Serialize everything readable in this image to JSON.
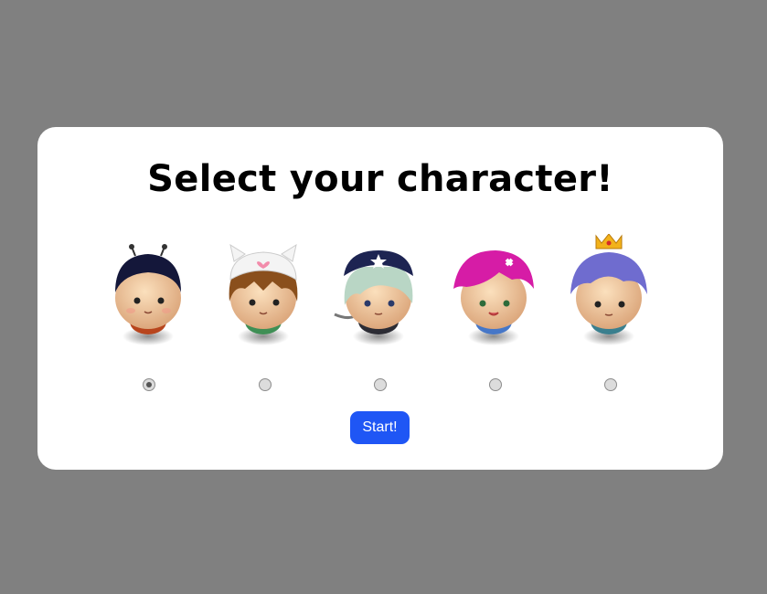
{
  "dialog": {
    "title": "Select your character!",
    "start_label": "Start!"
  },
  "characters": [
    {
      "icon": "antenna-boy-icon",
      "hair": "#14173a",
      "shirt": "#b8451d",
      "selected": true
    },
    {
      "icon": "cat-hat-girl-icon",
      "hair": "#8a4f1c",
      "shirt": "#3f8f55",
      "selected": false
    },
    {
      "icon": "pirate-icon",
      "hair": "#b9d6c5",
      "shirt": "#2c2c34",
      "selected": false
    },
    {
      "icon": "pink-hair-girl-icon",
      "hair": "#d61ca6",
      "shirt": "#4677c8",
      "selected": false
    },
    {
      "icon": "crowned-princess-icon",
      "hair": "#6f6ccf",
      "shirt": "#3a7f8e",
      "selected": false
    }
  ],
  "colors": {
    "background": "#808080",
    "card": "#ffffff",
    "button": "#1f56f5",
    "skin": "#f3cda0"
  }
}
